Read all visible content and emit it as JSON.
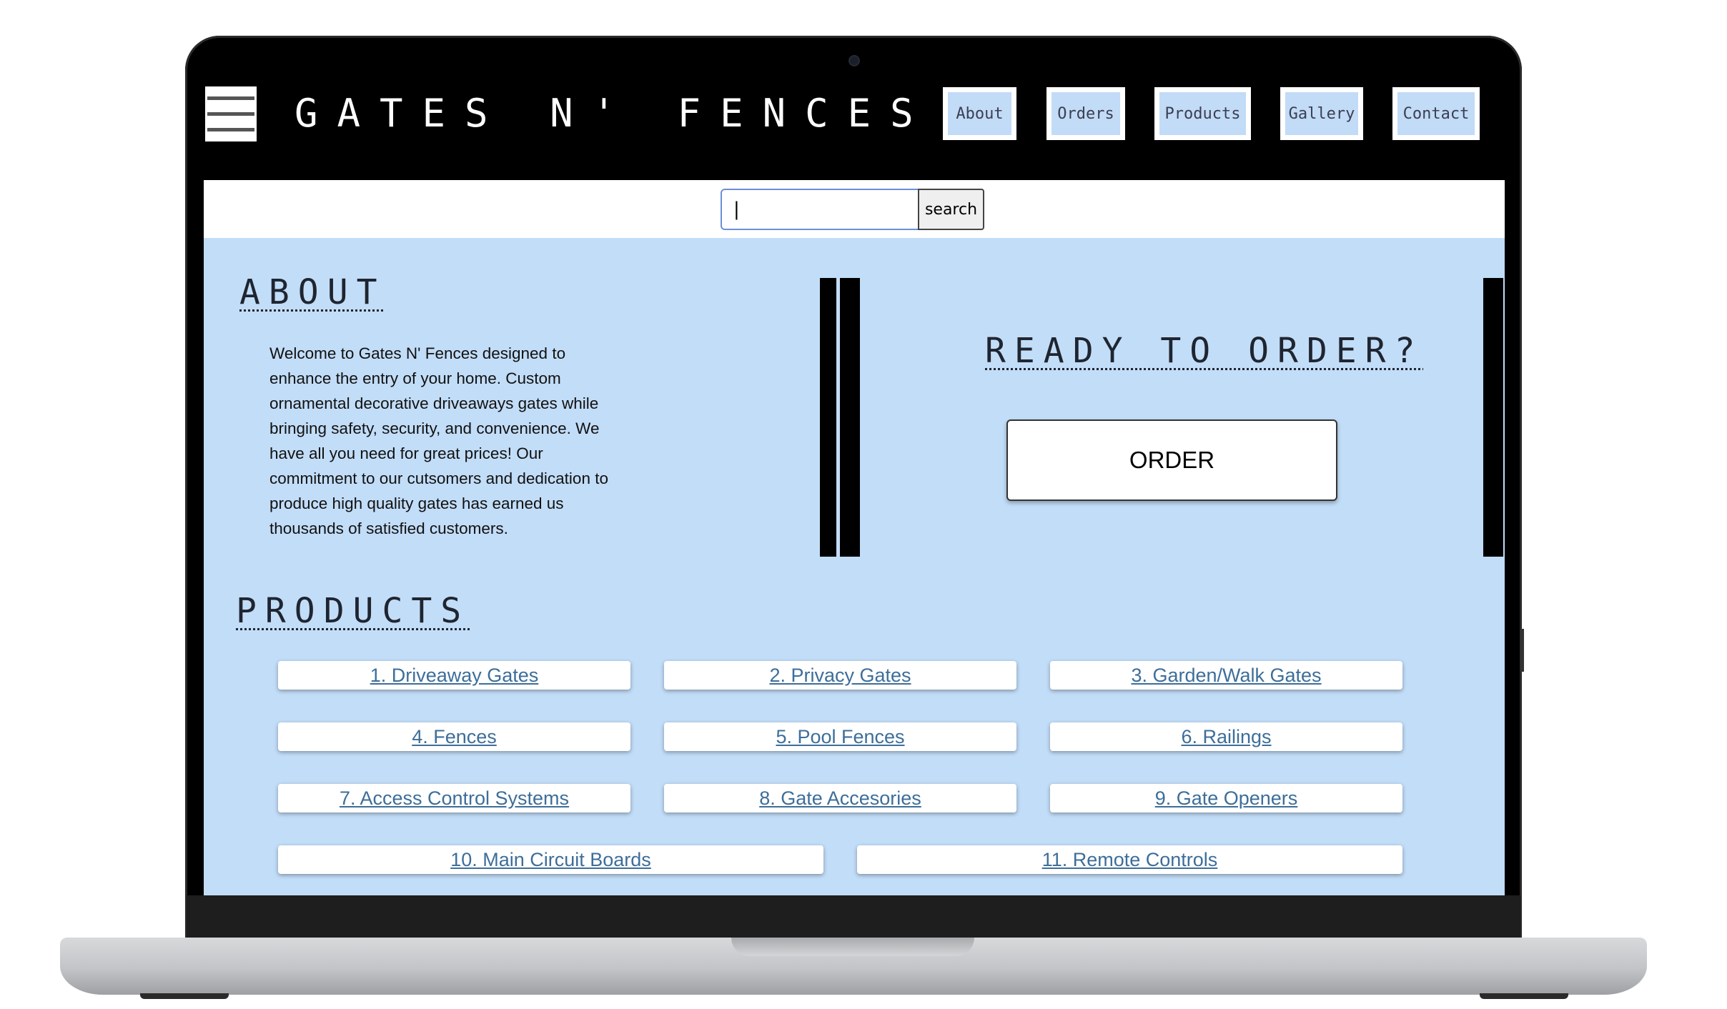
{
  "header": {
    "title": "GATES N' FENCES",
    "menu_icon": "hamburger-menu-icon",
    "nav": [
      {
        "label": "About"
      },
      {
        "label": "Orders"
      },
      {
        "label": "Products"
      },
      {
        "label": "Gallery"
      },
      {
        "label": "Contact"
      }
    ]
  },
  "search": {
    "value": "|",
    "button_label": "search"
  },
  "about": {
    "heading": "ABOUT",
    "text": "Welcome to Gates N' Fences designed to enhance the entry of your home. Custom ornamental decorative driveaways gates while bringing safety, security, and convenience. We have all you need for great prices! Our commitment to our cutsomers and dedication to produce high quality gates has earned us thousands of satisfied customers."
  },
  "order": {
    "heading": "READY TO ORDER?",
    "button_label": "ORDER"
  },
  "products": {
    "heading": "PRODUCTS",
    "items": [
      {
        "label": "1. Driveaway Gates"
      },
      {
        "label": "2. Privacy Gates"
      },
      {
        "label": "3. Garden/Walk Gates"
      },
      {
        "label": "4. Fences"
      },
      {
        "label": "5. Pool Fences"
      },
      {
        "label": "6. Railings"
      },
      {
        "label": "7. Access Control Systems"
      },
      {
        "label": "8. Gate Accesories"
      },
      {
        "label": "9. Gate Openers"
      },
      {
        "label": "10. Main Circuit Boards"
      },
      {
        "label": "11. Remote Controls"
      }
    ]
  },
  "colors": {
    "main_background": "#c2ddf8",
    "nav_button": "#c2dbf7",
    "link": "#3d6e9a",
    "header": "#000000"
  }
}
